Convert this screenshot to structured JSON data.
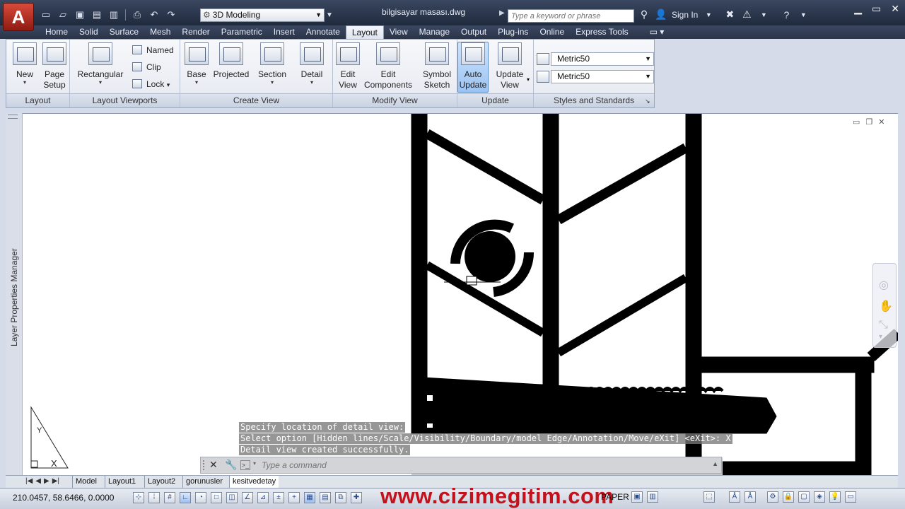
{
  "app": {
    "logo": "A",
    "document_title": "bilgisayar masası.dwg"
  },
  "quick_access": {
    "workspace": "3D Modeling",
    "buttons": [
      "new-icon",
      "open-icon",
      "save-icon",
      "saveas-icon",
      "publish-icon",
      "plot-icon",
      "undo-icon",
      "redo-icon"
    ]
  },
  "infocenter": {
    "search_placeholder": "Type a keyword or phrase",
    "sign_in": "Sign In"
  },
  "ribbon": {
    "tabs": [
      "Home",
      "Solid",
      "Surface",
      "Mesh",
      "Render",
      "Parametric",
      "Insert",
      "Annotate",
      "Layout",
      "View",
      "Manage",
      "Output",
      "Plug-ins",
      "Online",
      "Express Tools"
    ],
    "active_tab": "Layout",
    "panels": {
      "layout": {
        "title": "Layout",
        "new": "New",
        "page_setup_1": "Page",
        "page_setup_2": "Setup"
      },
      "viewports": {
        "title": "Layout Viewports",
        "rectangular": "Rectangular",
        "named": "Named",
        "clip": "Clip",
        "lock": "Lock"
      },
      "create_view": {
        "title": "Create View",
        "base": "Base",
        "projected": "Projected",
        "section": "Section",
        "detail": "Detail"
      },
      "modify_view": {
        "title": "Modify View",
        "edit_view_1": "Edit",
        "edit_view_2": "View",
        "edit_components_1": "Edit",
        "edit_components_2": "Components",
        "symbol_sketch_1": "Symbol",
        "symbol_sketch_2": "Sketch"
      },
      "update": {
        "title": "Update",
        "auto_update_1": "Auto",
        "auto_update_2": "Update",
        "update_view_1": "Update",
        "update_view_2": "View"
      },
      "styles": {
        "title": "Styles and Standards",
        "style_1": "Metric50",
        "style_2": "Metric50"
      }
    }
  },
  "palette": {
    "layer_properties": "Layer Properties Manager"
  },
  "command": {
    "history": [
      "Specify location of detail view:",
      "Select option [Hidden lines/Scale/Visibility/Boundary/model Edge/Annotation/Move/eXit] <eXit>: X",
      "Detail view created successfully."
    ],
    "placeholder": "Type a command"
  },
  "layout_tabs": {
    "tabs": [
      "Model",
      "Layout1",
      "Layout2",
      "gorunusler",
      "kesitvedetay"
    ],
    "active": "kesitvedetay"
  },
  "status": {
    "coordinates": "210.0457, 58.6466, 0.0000",
    "space": "PAPER",
    "watermark": "www.cizimegitim.com"
  }
}
